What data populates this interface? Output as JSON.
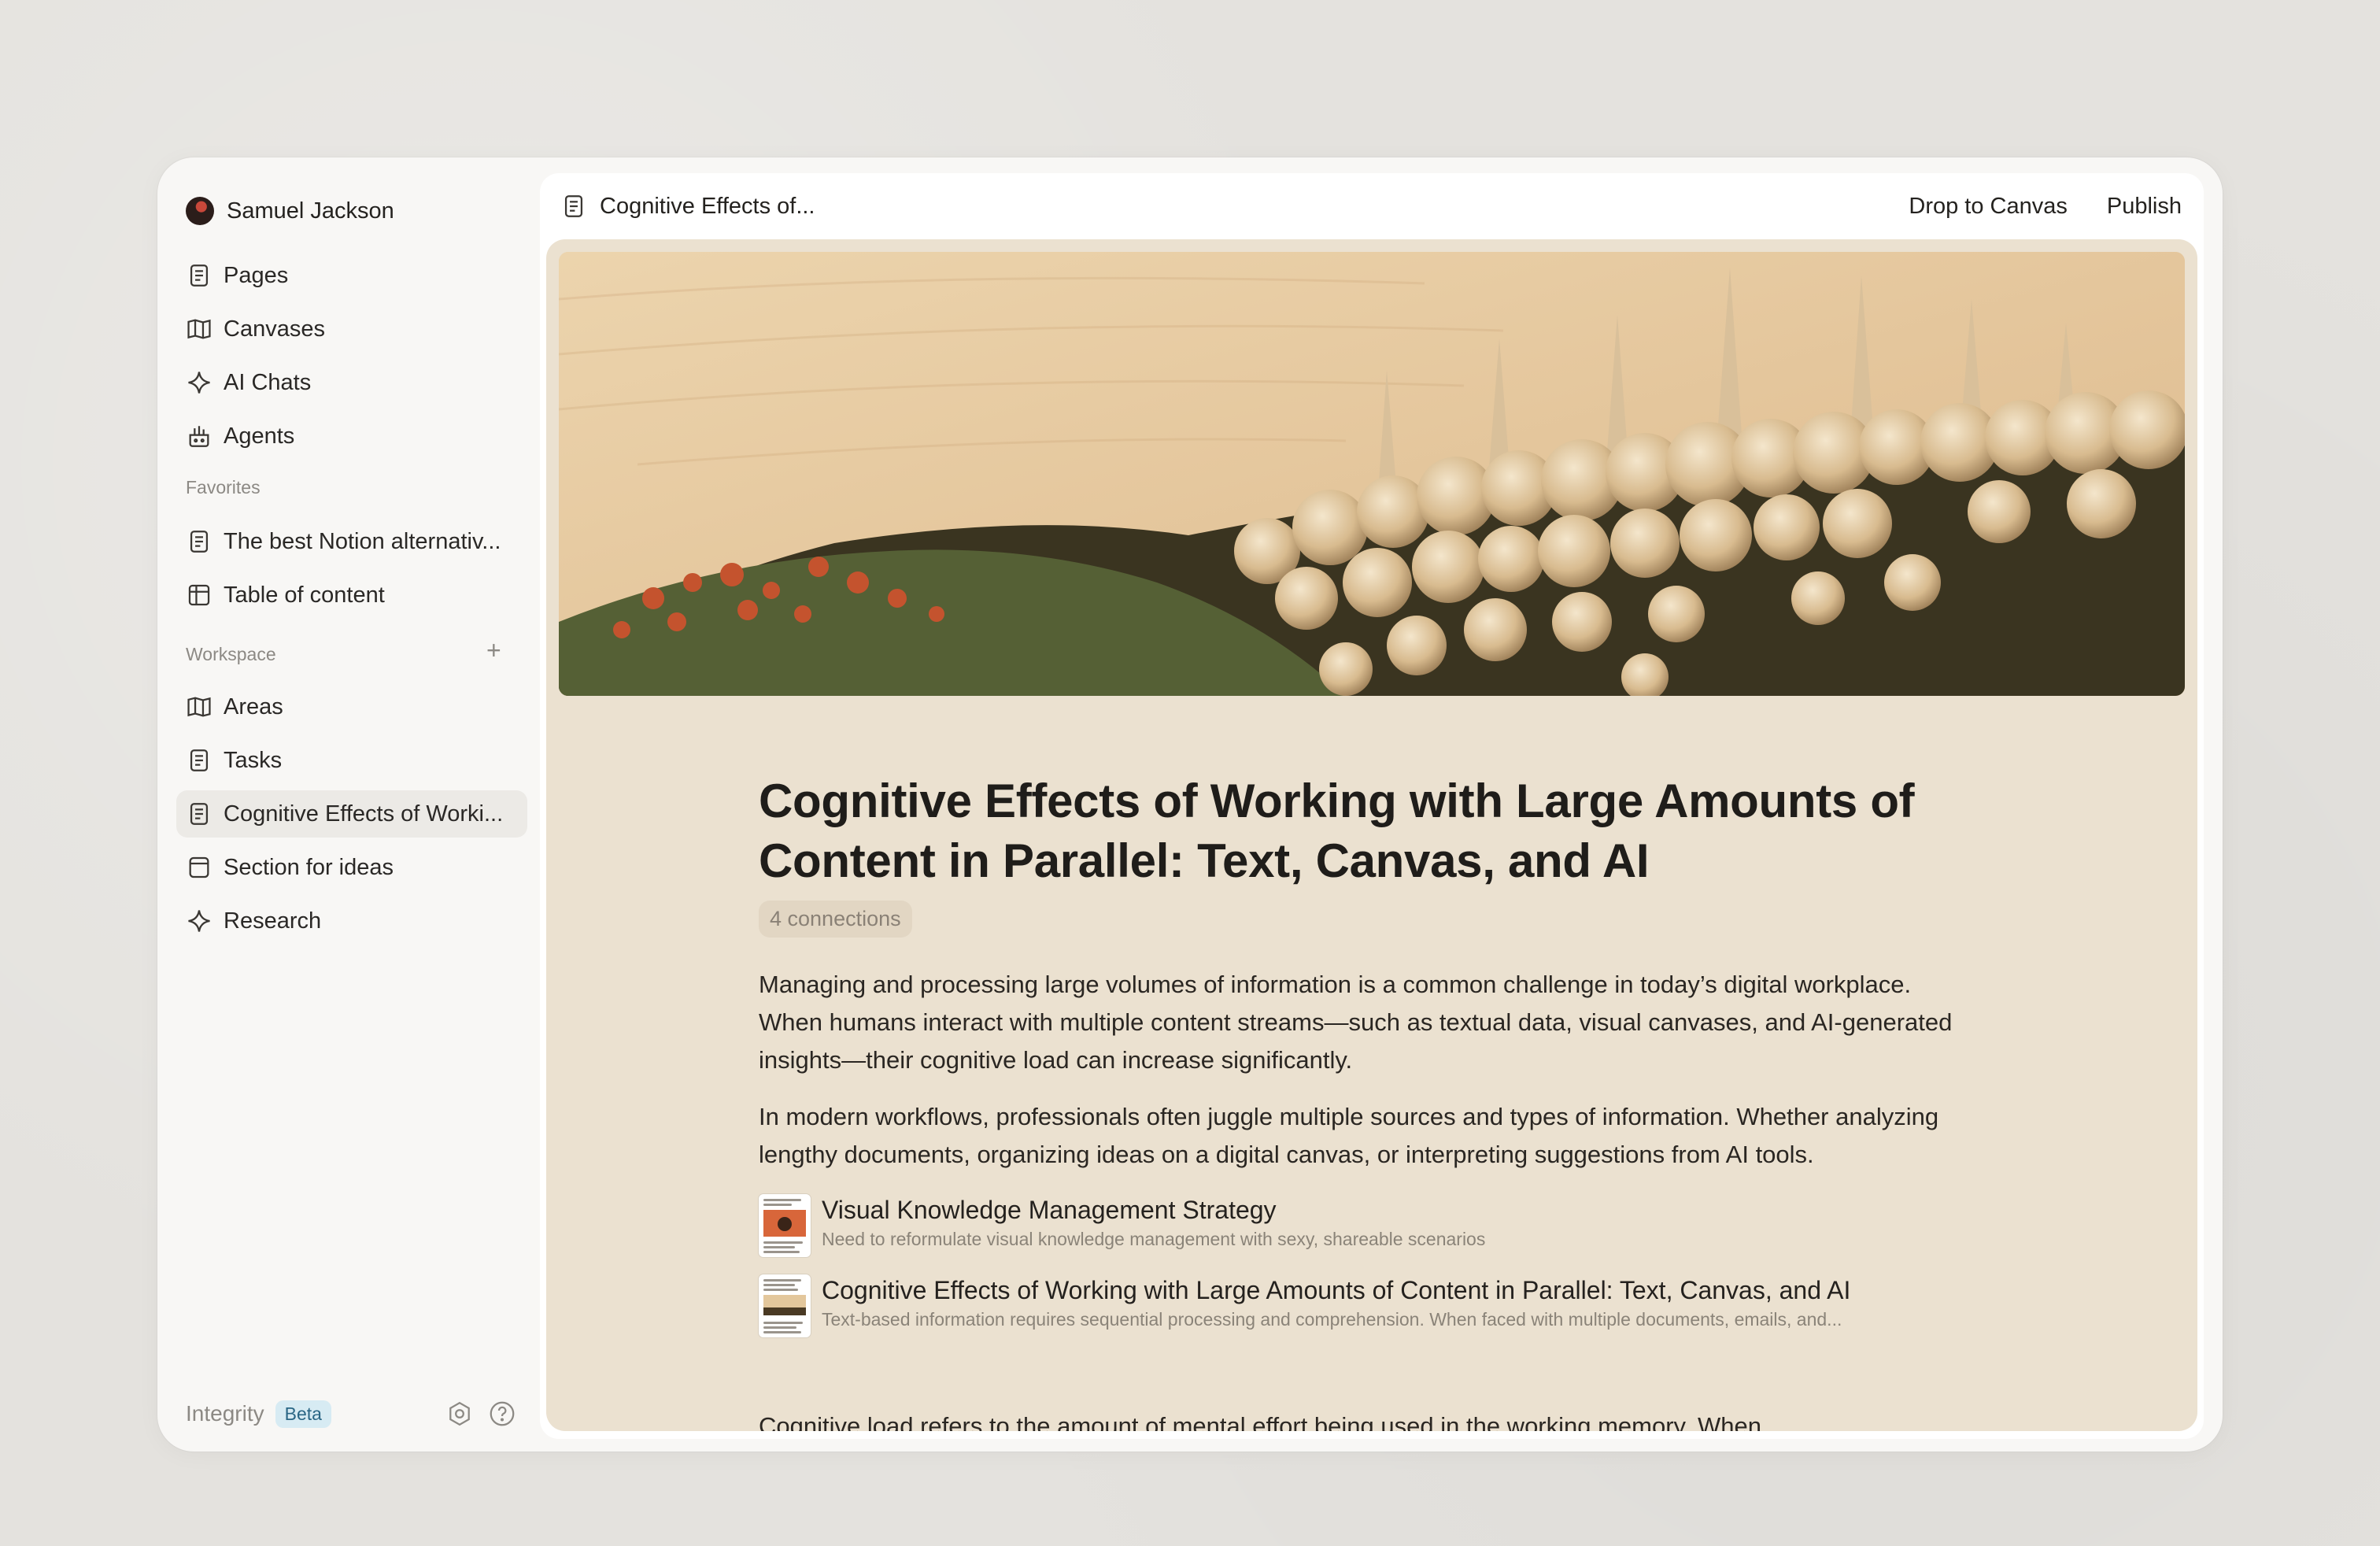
{
  "user": {
    "name": "Samuel Jackson"
  },
  "nav": [
    {
      "label": "Pages",
      "icon": "page-icon"
    },
    {
      "label": "Canvases",
      "icon": "book-icon"
    },
    {
      "label": "AI Chats",
      "icon": "sparkle-icon"
    },
    {
      "label": "Agents",
      "icon": "agent-icon"
    }
  ],
  "favorites": {
    "label": "Favorites",
    "items": [
      {
        "label": "The best Notion alternativ...",
        "icon": "page-icon"
      },
      {
        "label": "Table of content",
        "icon": "table-icon"
      }
    ]
  },
  "workspace": {
    "label": "Workspace",
    "add": "+",
    "items": [
      {
        "label": "Areas",
        "icon": "book-icon"
      },
      {
        "label": "Tasks",
        "icon": "page-icon"
      },
      {
        "label": "Cognitive Effects of Worki...",
        "icon": "page-icon",
        "active": true
      },
      {
        "label": "Section for ideas",
        "icon": "section-icon"
      },
      {
        "label": "Research",
        "icon": "sparkle-icon"
      }
    ]
  },
  "footer": {
    "brand": "Integrity",
    "badge": "Beta"
  },
  "topbar": {
    "doc_title": "Cognitive Effects of...",
    "drop_canvas": "Drop to Canvas",
    "publish": "Publish"
  },
  "article": {
    "title": "Cognitive Effects of Working with Large Amounts of Content in Parallel: Text, Canvas, and AI",
    "connections": "4 connections",
    "para1": "Managing and processing large volumes of information is a common challenge in today’s digital workplace. When humans interact with multiple content streams—such as textual data, visual canvases, and AI-generated insights—their cognitive load can increase significantly.",
    "para2": "In modern workflows, professionals often juggle multiple sources and types of information. Whether analyzing lengthy documents, organizing ideas on a digital canvas, or interpreting suggestions from AI tools.",
    "links": [
      {
        "title": "Visual Knowledge Management Strategy",
        "desc": "Need to reformulate visual knowledge management with sexy, shareable scenarios"
      },
      {
        "title": "Cognitive Effects of Working with Large Amounts of Content in Parallel: Text, Canvas, and AI",
        "desc": "Text-based information requires sequential processing and comprehension. When faced with multiple documents, emails, and..."
      }
    ],
    "cutoff": "Cognitive load refers to the amount of mental effort being used in the working memory. When"
  },
  "colors": {
    "content_bg": "#ebe1d0",
    "badge_bg": "#d7ebf3",
    "badge_text": "#2a6685"
  }
}
